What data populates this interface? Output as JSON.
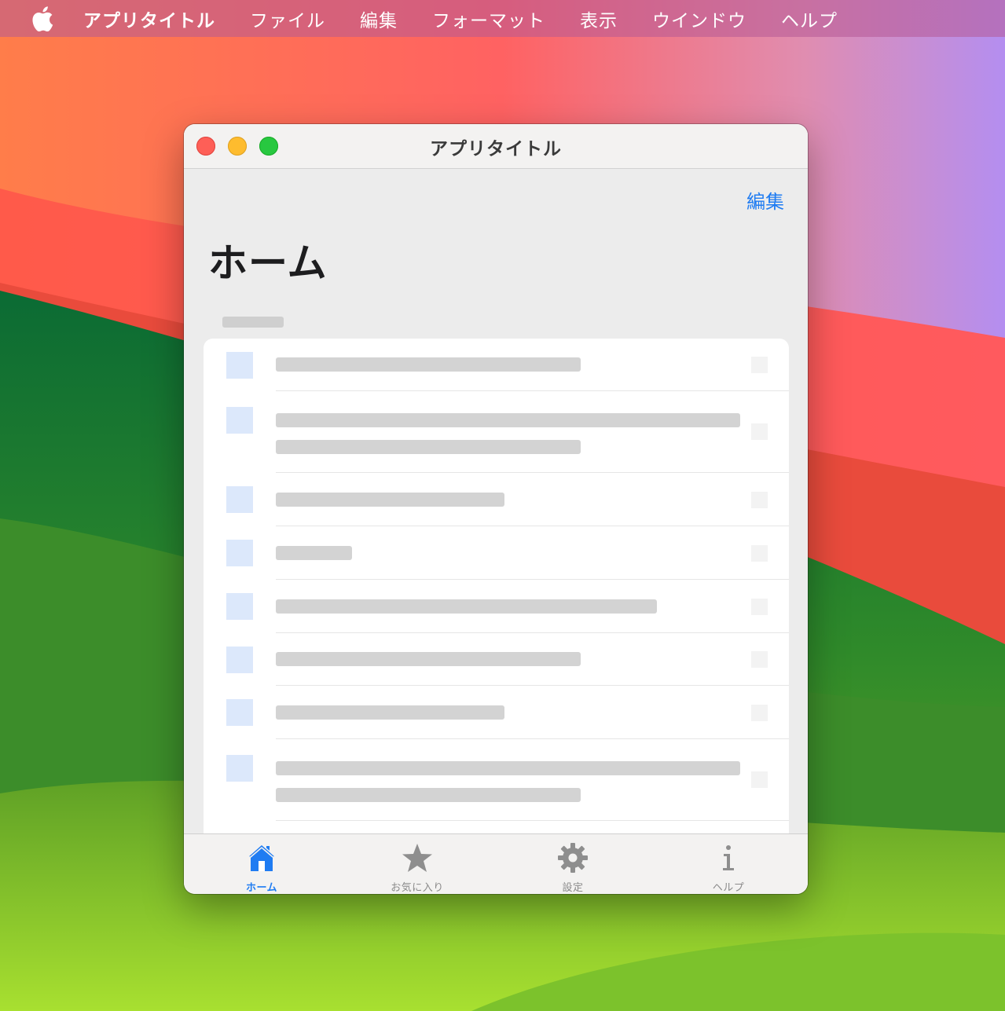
{
  "menubar": {
    "apple_icon": "apple-logo-icon",
    "app_name": "アプリタイトル",
    "items": [
      "ファイル",
      "編集",
      "フォーマット",
      "表示",
      "ウインドウ",
      "ヘルプ"
    ]
  },
  "window": {
    "title": "アプリタイトル",
    "edit_label": "編集",
    "page_title": "ホーム"
  },
  "tabs": [
    {
      "label": "ホーム",
      "icon": "house-icon",
      "active": true
    },
    {
      "label": "お気に入り",
      "icon": "star-icon",
      "active": false
    },
    {
      "label": "設定",
      "icon": "gear-icon",
      "active": false
    },
    {
      "label": "ヘルプ",
      "icon": "info-icon",
      "active": false
    }
  ],
  "colors": {
    "accent": "#1f7cf2",
    "thumb_placeholder": "#dce8fb",
    "text_placeholder": "#d3d3d3",
    "close": "#fe5f57",
    "minimize": "#febc2e",
    "maximize": "#28c840"
  }
}
